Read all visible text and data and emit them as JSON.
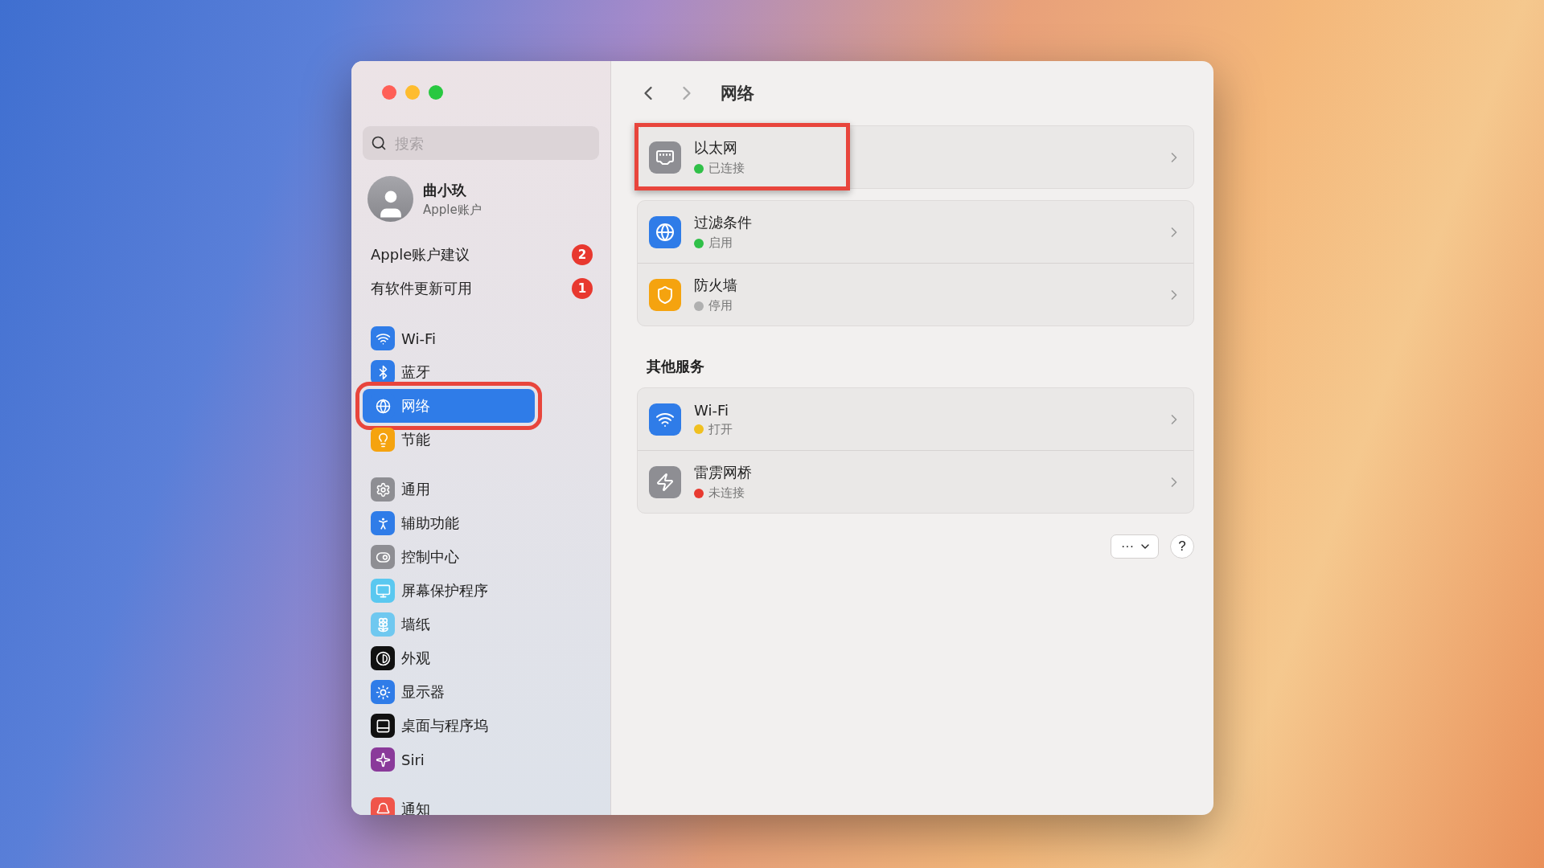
{
  "sidebar": {
    "search": {
      "placeholder": "搜索"
    },
    "account": {
      "name": "曲小玖",
      "subtitle": "Apple账户"
    },
    "notices": [
      {
        "label": "Apple账户建议",
        "count": "2"
      },
      {
        "label": "有软件更新可用",
        "count": "1"
      }
    ],
    "groups": [
      [
        {
          "label": "Wi-Fi",
          "selected": false,
          "annotated": false
        },
        {
          "label": "蓝牙",
          "selected": false,
          "annotated": false
        },
        {
          "label": "网络",
          "selected": true,
          "annotated": true
        },
        {
          "label": "节能",
          "selected": false,
          "annotated": false
        }
      ],
      [
        {
          "label": "通用",
          "selected": false,
          "annotated": false
        },
        {
          "label": "辅助功能",
          "selected": false,
          "annotated": false
        },
        {
          "label": "控制中心",
          "selected": false,
          "annotated": false
        },
        {
          "label": "屏幕保护程序",
          "selected": false,
          "annotated": false
        },
        {
          "label": "墙纸",
          "selected": false,
          "annotated": false
        },
        {
          "label": "外观",
          "selected": false,
          "annotated": false
        },
        {
          "label": "显示器",
          "selected": false,
          "annotated": false
        },
        {
          "label": "桌面与程序坞",
          "selected": false,
          "annotated": false
        },
        {
          "label": "Siri",
          "selected": false,
          "annotated": false
        }
      ],
      [
        {
          "label": "通知",
          "selected": false,
          "annotated": false
        }
      ]
    ]
  },
  "main": {
    "title": "网络",
    "groups": [
      {
        "items": [
          {
            "name": "以太网",
            "status": "已连接",
            "color": "#30c048",
            "annotated": true
          }
        ]
      },
      {
        "items": [
          {
            "name": "过滤条件",
            "status": "启用",
            "color": "#30c048",
            "annotated": false
          },
          {
            "name": "防火墙",
            "status": "停用",
            "color": "#b0b0b0",
            "annotated": false
          }
        ]
      },
      {
        "heading": "其他服务",
        "items": [
          {
            "name": "Wi-Fi",
            "status": "打开",
            "color": "#f0c020",
            "annotated": false
          },
          {
            "name": "雷雳网桥",
            "status": "未连接",
            "color": "#e83a30",
            "annotated": false
          }
        ]
      }
    ],
    "more_button": "···",
    "help_button": "?"
  }
}
